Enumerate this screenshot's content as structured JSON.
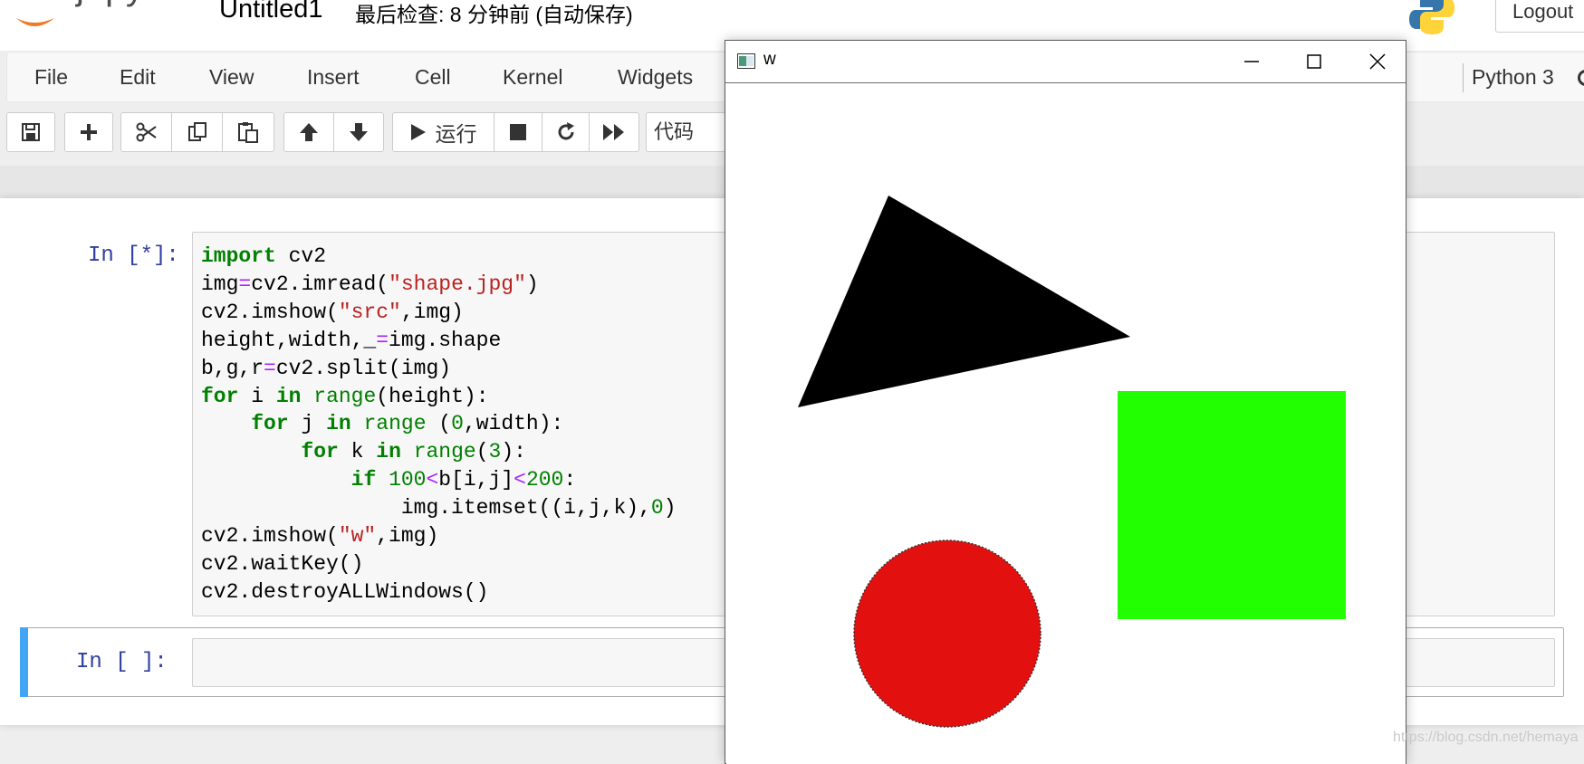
{
  "header": {
    "logo_text": "jupyter",
    "notebook_title": "Untitled1",
    "checkpoint_status": "最后检查: 8 分钟前  (自动保存)",
    "logout_label": "Logout"
  },
  "menubar": {
    "items": [
      "File",
      "Edit",
      "View",
      "Insert",
      "Cell",
      "Kernel",
      "Widgets"
    ],
    "kernel_name": "Python 3"
  },
  "toolbar": {
    "run_label": "运行",
    "cell_type": "代码",
    "icons": [
      "save-icon",
      "plus-icon",
      "cut-icon",
      "copy-icon",
      "paste-icon",
      "arrow-up-icon",
      "arrow-down-icon",
      "play-icon",
      "stop-icon",
      "restart-icon",
      "fast-forward-icon"
    ]
  },
  "cells": [
    {
      "prompt": "In  [*]:",
      "code_lines": [
        "import cv2",
        "img=cv2.imread(\"shape.jpg\")",
        "cv2.imshow(\"src\",img)",
        "height,width,_=img.shape",
        "b,g,r=cv2.split(img)",
        "for i in range(height):",
        "    for j in range (0,width):",
        "        for k in range(3):",
        "            if 100<b[i,j]<200:",
        "                img.itemset((i,j,k),0)",
        "cv2.imshow(\"w\",img)",
        "cv2.waitKey()",
        "cv2.destroyALLWindows()"
      ]
    },
    {
      "prompt": "In  [ ]:",
      "code_lines": []
    }
  ],
  "cv_window": {
    "title": "w",
    "shapes": [
      {
        "type": "triangle",
        "color": "#000000"
      },
      {
        "type": "square",
        "color": "#22ff00"
      },
      {
        "type": "circle",
        "color": "#e31010"
      }
    ]
  },
  "colors": {
    "prompt": "#303f9f",
    "selected_cell_bar": "#42a5f5",
    "keyword": "#008000",
    "string": "#ba2121",
    "operator": "#aa22ff"
  },
  "watermark": "https://blog.csdn.net/hemaya"
}
